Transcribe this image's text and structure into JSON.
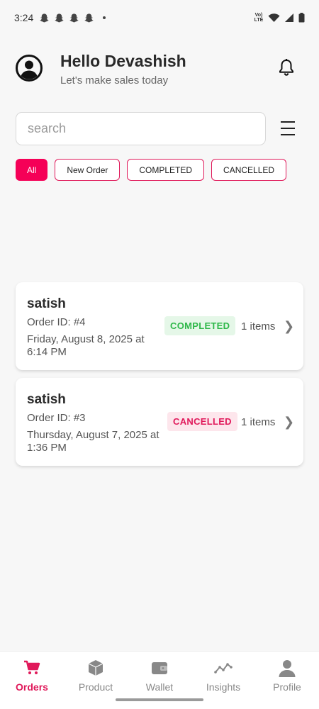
{
  "status_bar": {
    "time": "3:24",
    "network_label": "Vo) LTE",
    "icons": [
      "snapchat-ghost-icon",
      "snapchat-ghost-icon",
      "snapchat-ghost-icon",
      "snapchat-ghost-icon",
      "notification-dot-icon",
      "wifi-icon",
      "cell-signal-icon",
      "battery-icon"
    ]
  },
  "header": {
    "greeting": "Hello Devashish",
    "subtitle": "Let's make sales today",
    "avatar_icon": "user-avatar-icon",
    "notification_icon": "bell-icon"
  },
  "search": {
    "placeholder": "search",
    "value": "",
    "menu_icon": "hamburger-menu-icon"
  },
  "filters": [
    {
      "label": "All",
      "active": true
    },
    {
      "label": "New Order",
      "active": false
    },
    {
      "label": "COMPLETED",
      "active": false
    },
    {
      "label": "CANCELLED",
      "active": false
    }
  ],
  "orders": [
    {
      "customer": "satish",
      "order_id": "Order ID: #4",
      "date": "Friday, August 8, 2025 at 6:14 PM",
      "status": "COMPLETED",
      "items": "1 items"
    },
    {
      "customer": "satish",
      "order_id": "Order ID: #3",
      "date": "Thursday, August 7, 2025 at 1:36 PM",
      "status": "CANCELLED",
      "items": "1 items"
    }
  ],
  "colors": {
    "accent": "#f50057",
    "completed_text": "#2fb84a",
    "completed_bg": "#e5f7e8",
    "cancelled_text": "#e0195a",
    "cancelled_bg": "#fde6ec"
  },
  "bottom_nav": [
    {
      "label": "Orders",
      "icon": "cart-icon",
      "active": true
    },
    {
      "label": "Product",
      "icon": "box-icon",
      "active": false
    },
    {
      "label": "Wallet",
      "icon": "wallet-icon",
      "active": false
    },
    {
      "label": "Insights",
      "icon": "trend-line-icon",
      "active": false
    },
    {
      "label": "Profile",
      "icon": "person-icon",
      "active": false
    }
  ]
}
